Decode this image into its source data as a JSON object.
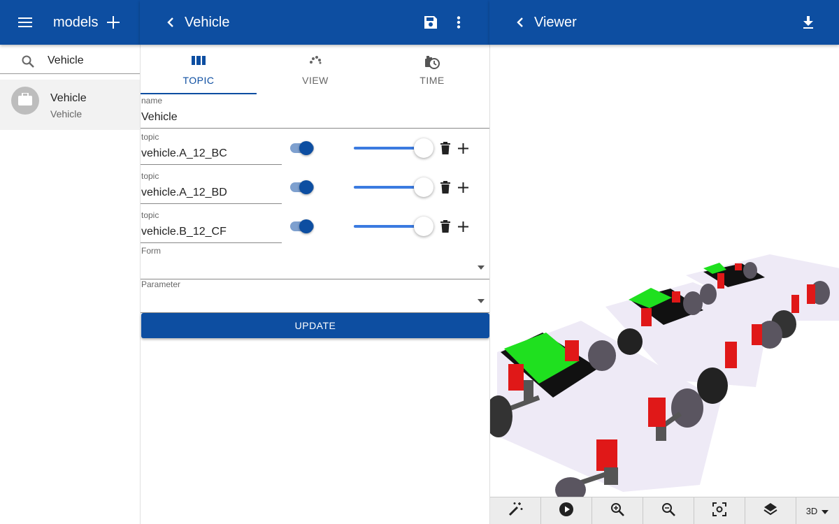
{
  "left_bar": {
    "title": "models",
    "menu_icon": "menu-icon",
    "add_icon": "plus-icon"
  },
  "mid_bar": {
    "title": "Vehicle",
    "back_icon": "chevron-left-icon",
    "save_icon": "save-icon",
    "more_icon": "more-vert-icon"
  },
  "right_bar": {
    "title": "Viewer",
    "back_icon": "chevron-left-icon",
    "download_icon": "download-icon"
  },
  "sidebar": {
    "search": {
      "value": "Vehicle",
      "icon": "search-icon"
    },
    "items": [
      {
        "primary": "Vehicle",
        "secondary": "Vehicle",
        "icon": "briefcase-icon"
      }
    ]
  },
  "tabs": [
    {
      "label": "TOPIC",
      "icon": "columns-icon",
      "active": true
    },
    {
      "label": "VIEW",
      "icon": "view-icon",
      "active": false
    },
    {
      "label": "TIME",
      "icon": "clock-icon",
      "active": false
    }
  ],
  "form": {
    "name_label": "name",
    "name_value": "Vehicle",
    "topics": [
      {
        "label": "topic",
        "value": "vehicle.A_12_BC",
        "enabled": true,
        "level": 1.0
      },
      {
        "label": "topic",
        "value": "vehicle.A_12_BD",
        "enabled": true,
        "level": 1.0
      },
      {
        "label": "topic",
        "value": "vehicle.B_12_CF",
        "enabled": true,
        "level": 1.0
      }
    ],
    "form_label": "Form",
    "form_value": "",
    "parameter_label": "Parameter",
    "parameter_value": "",
    "update_label": "UPDATE"
  },
  "viewer_toolbar": {
    "buttons": [
      "magic-wand-icon",
      "play-icon",
      "zoom-in-icon",
      "zoom-out-icon",
      "focus-icon",
      "layers-icon"
    ],
    "mode": "3D"
  },
  "colors": {
    "primary": "#0d4ea1",
    "accent": "#3b7be0"
  }
}
